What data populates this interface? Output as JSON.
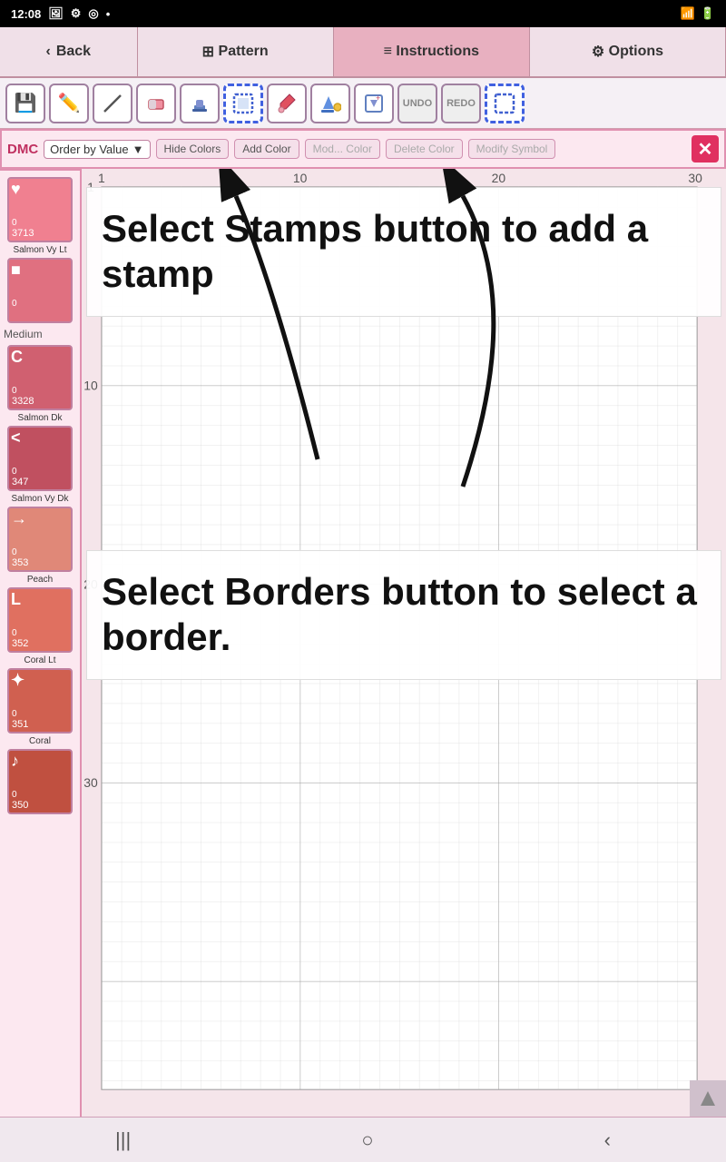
{
  "statusBar": {
    "time": "12:08",
    "icons": [
      "photo",
      "settings",
      "location",
      "dot"
    ]
  },
  "nav": {
    "back": "Back",
    "pattern": "Pattern",
    "instructions": "Instructions",
    "options": "Options"
  },
  "toolbar": {
    "tools": [
      {
        "name": "save",
        "icon": "💾"
      },
      {
        "name": "pencil",
        "icon": "✏️"
      },
      {
        "name": "line",
        "icon": "╱"
      },
      {
        "name": "eraser",
        "icon": "🩹"
      },
      {
        "name": "stamp",
        "icon": "🖃"
      },
      {
        "name": "border",
        "icon": "⬛"
      },
      {
        "name": "eyedropper",
        "icon": "💉"
      },
      {
        "name": "fill",
        "icon": "🪣"
      },
      {
        "name": "select",
        "icon": "✨"
      },
      {
        "name": "undo",
        "icon": "UNDO"
      },
      {
        "name": "redo",
        "icon": "REDO"
      },
      {
        "name": "marquee",
        "icon": "⬚"
      }
    ]
  },
  "colorBar": {
    "dmc": "DMC",
    "order": "Order by Value",
    "hideColors": "Hide Colors",
    "addColor": "Add Color",
    "modifyColor": "Mod... Color",
    "deleteColor": "Delete Color",
    "modifySymbol": "Modify Symbol"
  },
  "palette": {
    "items": [
      {
        "symbol": "♥",
        "count": "0",
        "number": "3713",
        "name": "Salmon Vy Lt",
        "color": "#f08090"
      },
      {
        "symbol": "■",
        "count": "0",
        "number": "",
        "name": "",
        "color": "#e07080"
      },
      {
        "symbol": "C",
        "count": "0",
        "number": "3328",
        "name": "Salmon Dk",
        "color": "#d06070",
        "sectionLabel": "Medium"
      },
      {
        "symbol": "<",
        "count": "0",
        "number": "347",
        "name": "Salmon Vy Dk",
        "color": "#c05060"
      },
      {
        "symbol": "→",
        "count": "0",
        "number": "353",
        "name": "Peach",
        "color": "#e08878"
      },
      {
        "symbol": "L",
        "count": "0",
        "number": "352",
        "name": "Coral Lt",
        "color": "#e07060"
      },
      {
        "symbol": "✦",
        "count": "0",
        "number": "351",
        "name": "Coral",
        "color": "#d06050"
      },
      {
        "symbol": "♪",
        "count": "0",
        "number": "350",
        "name": "",
        "color": "#c05040"
      }
    ]
  },
  "instructions": {
    "block1": "Select Stamps button to add a stamp",
    "block2": "Select Borders button to select a border."
  },
  "grid": {
    "colLabels": [
      1,
      10,
      20,
      30
    ],
    "rowLabels": [
      1,
      10,
      20,
      30
    ]
  },
  "bottomBar": {
    "icons": [
      "|||",
      "○",
      "<"
    ]
  }
}
